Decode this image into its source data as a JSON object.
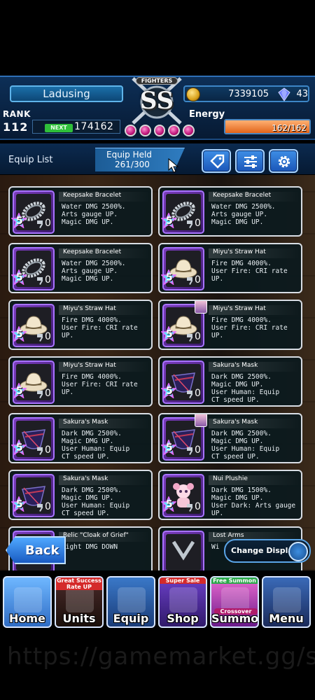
{
  "header": {
    "player_name": "Ladusing",
    "emblem_text": "SS",
    "emblem_banner": "FIGHTERS",
    "gold": "7339105",
    "gems": "43",
    "rank_label": "RANK",
    "rank": "112",
    "next_label": "NEXT",
    "next_exp": "174162",
    "energy_label": "Energy",
    "energy_value": "162/162",
    "energy_fraction": 1.0
  },
  "equip_bar": {
    "title": "Equip List",
    "held_label": "Equip Held",
    "held_value": "261/300"
  },
  "cards": [
    {
      "name": "Keepsake Bracelet",
      "desc": "Water DMG 2500%.\nArts gauge UP.\nMagic DMG UP.",
      "stars": "5",
      "level": "0",
      "icon": "bracelet-icon"
    },
    {
      "name": "Keepsake Bracelet",
      "desc": "Water DMG 2500%.\nArts gauge UP.\nMagic DMG UP.",
      "stars": "5",
      "level": "0",
      "icon": "bracelet-icon"
    },
    {
      "name": "Keepsake Bracelet",
      "desc": "Water DMG 2500%.\nArts gauge UP.\nMagic DMG UP.",
      "stars": "5",
      "level": "0",
      "icon": "bracelet-icon"
    },
    {
      "name": "Miyu's Straw Hat",
      "desc": "Fire DMG 4000%.\nUser Fire: CRI rate\nUP.",
      "stars": "5",
      "level": "0",
      "icon": "straw-hat-icon"
    },
    {
      "name": "Miyu's Straw Hat",
      "desc": "Fire DMG 4000%.\nUser Fire: CRI rate\nUP.",
      "stars": "5",
      "level": "0",
      "icon": "straw-hat-icon"
    },
    {
      "name": "Miyu's Straw Hat",
      "desc": "Fire DMG 4000%.\nUser Fire: CRI rate\nUP.",
      "stars": "5",
      "level": "0",
      "icon": "straw-hat-icon"
    },
    {
      "name": "Miyu's Straw Hat",
      "desc": "Fire DMG 4000%.\nUser Fire: CRI rate\nUP.",
      "stars": "5",
      "level": "0",
      "icon": "straw-hat-icon"
    },
    {
      "name": "Sakura's Mask",
      "desc": "Dark DMG 2500%.\nMagic DMG UP.\nUser Human: Equip\nCT speed UP.",
      "stars": "5",
      "level": "0",
      "icon": "mask-icon"
    },
    {
      "name": "Sakura's Mask",
      "desc": "Dark DMG 2500%.\nMagic DMG UP.\nUser Human: Equip\nCT speed UP.",
      "stars": "5",
      "level": "0",
      "icon": "mask-icon"
    },
    {
      "name": "Sakura's Mask",
      "desc": "Dark DMG 2500%.\nMagic DMG UP.\nUser Human: Equip\nCT speed UP.",
      "stars": "5",
      "level": "0",
      "icon": "mask-icon"
    },
    {
      "name": "Sakura's Mask",
      "desc": "Dark DMG 2500%.\nMagic DMG UP.\nUser Human: Equip\nCT speed UP.",
      "stars": "5",
      "level": "0",
      "icon": "mask-icon"
    },
    {
      "name": "Nui Plushie",
      "desc": "Dark DMG 1500%.\nMagic DMG UP.\nUser Dark: Arts gauge\nUP.",
      "stars": "5",
      "level": "0",
      "icon": "plushie-icon"
    },
    {
      "name": "Relic \"Cloak of Grief\"",
      "desc": "Light DMG DOWN",
      "stars": "",
      "level": "",
      "icon": "cloak-icon"
    },
    {
      "name": "Lost Arms",
      "desc": "Wi",
      "stars": "",
      "level": "",
      "icon": "arms-icon"
    }
  ],
  "controls": {
    "back_label": "Back",
    "change_display_label": "Change Display"
  },
  "nav": [
    {
      "label": "Home",
      "tag": ""
    },
    {
      "label": "Units",
      "tag": "Great Success Rate UP"
    },
    {
      "label": "Equip",
      "tag": ""
    },
    {
      "label": "Shop",
      "tag": "Super Sale"
    },
    {
      "label": "Summon",
      "tag": "Free Summon",
      "sub": "Crossover"
    },
    {
      "label": "Menu",
      "tag": ""
    }
  ],
  "watermark": "https://gamemarket.gg/s",
  "colors": {
    "accent_blue": "#2f7cc0",
    "energy_orange": "#e1641a",
    "rarity_purple": "#7b3dbd"
  }
}
